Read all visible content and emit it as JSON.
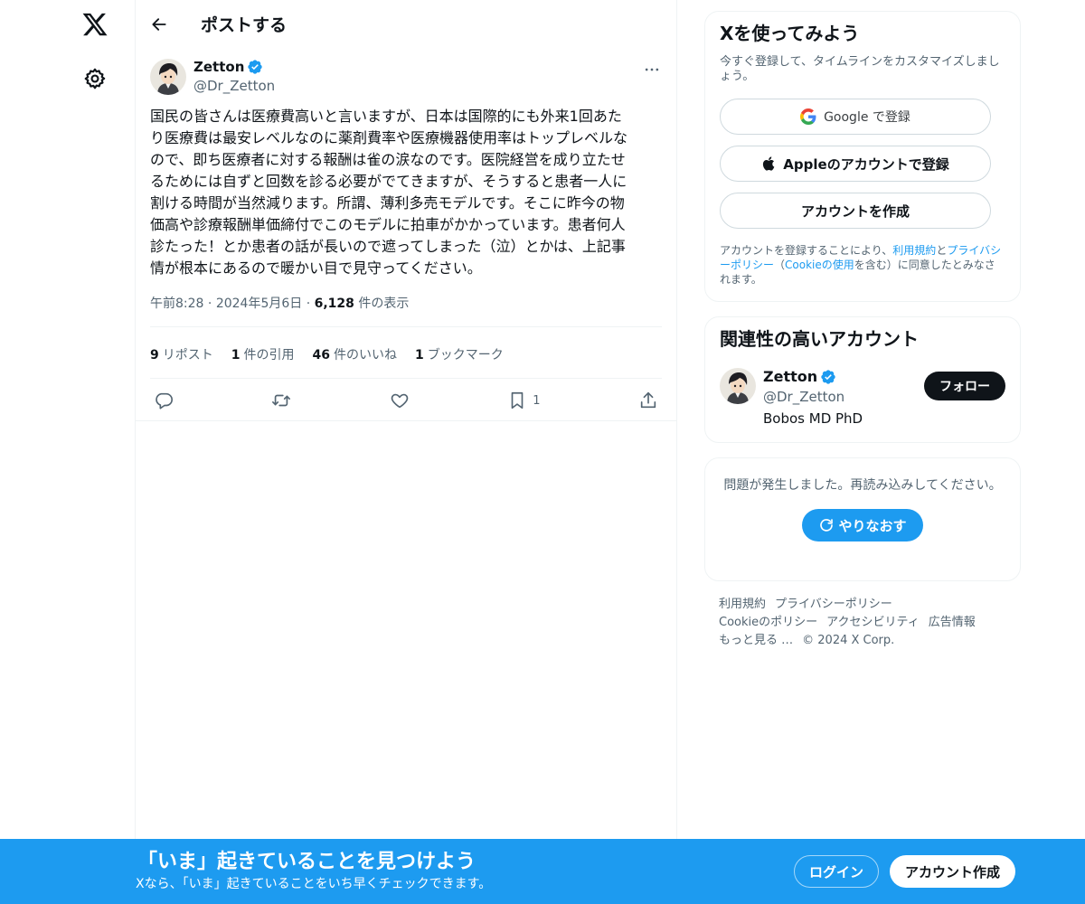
{
  "header": {
    "title": "ポストする"
  },
  "post": {
    "author_name": "Zetton",
    "author_handle": "@Dr_Zetton",
    "text": "国民の皆さんは医療費高いと言いますが、日本は国際的にも外来1回あた\nり医療費は最安レベルなのに薬剤費率や医療機器使用率はトップレベルな\nので、即ち医療者に対する報酬は雀の涙なのです。医院経営を成り立たせ\nるためには自ずと回数を診る必要がでてきますが、そうすると患者一人に\n割ける時間が当然減ります。所謂、薄利多売モデルです。そこに昨今の物\n価高や診療報酬単価締付でこのモデルに拍車がかかっています。患者何人\n診たった！とか患者の話が長いので遮ってしまった（泣）とかは、上記事\n情が根本にあるので暖かい目で見守ってください。",
    "time": "午前8:28",
    "date": "2024年5月6日",
    "views_count": "6,128",
    "views_label": "件の表示",
    "stats": [
      {
        "count": "9",
        "label": "リポスト"
      },
      {
        "count": "1",
        "label": "件の引用"
      },
      {
        "count": "46",
        "label": "件のいいね"
      },
      {
        "count": "1",
        "label": "ブックマーク"
      }
    ],
    "bookmark_count": "1"
  },
  "signup_card": {
    "title": "Xを使ってみよう",
    "subtitle": "今すぐ登録して、タイムラインをカスタマイズしましょう。",
    "google_label": "Google で登録",
    "apple_label": "Appleのアカウントで登録",
    "create_label": "アカウントを作成",
    "legal_prefix": "アカウントを登録することにより、",
    "legal_terms": "利用規約",
    "legal_and": "と",
    "legal_privacy": "プライバシーポリシー",
    "legal_open": "（",
    "legal_cookie": "Cookieの使用",
    "legal_suffix": "を含む）に同意したとみなされます。"
  },
  "related": {
    "title": "関連性の高いアカウント",
    "name": "Zetton",
    "handle": "@Dr_Zetton",
    "bio": "Bobos MD PhD",
    "follow_label": "フォロー"
  },
  "error_card": {
    "message": "問題が発生しました。再読み込みしてください。",
    "retry_label": "やりなおす"
  },
  "footer": {
    "terms": "利用規約",
    "privacy": "プライバシーポリシー",
    "cookie": "Cookieのポリシー",
    "accessibility": "アクセシビリティ",
    "ads": "広告情報",
    "more": "もっと見る …",
    "copyright": "© 2024 X Corp."
  },
  "banner": {
    "title": "「いま」起きていることを見つけよう",
    "subtitle": "Xなら、「いま」起きていることをいち早くチェックできます。",
    "login_label": "ログイン",
    "signup_label": "アカウント作成"
  },
  "colors": {
    "accent": "#1d9bf0",
    "text_primary": "#0f1419",
    "text_secondary": "#536471",
    "border": "#eff3f4"
  },
  "icons": {
    "logo": "x-logo-icon",
    "settings": "gear-icon",
    "back": "arrow-left-icon",
    "more": "more-dots-icon",
    "reply": "reply-icon",
    "repost": "repost-icon",
    "like": "heart-icon",
    "bookmark": "bookmark-icon",
    "share": "share-icon",
    "verified": "verified-badge-icon",
    "google": "google-icon",
    "apple": "apple-icon",
    "retry": "refresh-icon"
  }
}
